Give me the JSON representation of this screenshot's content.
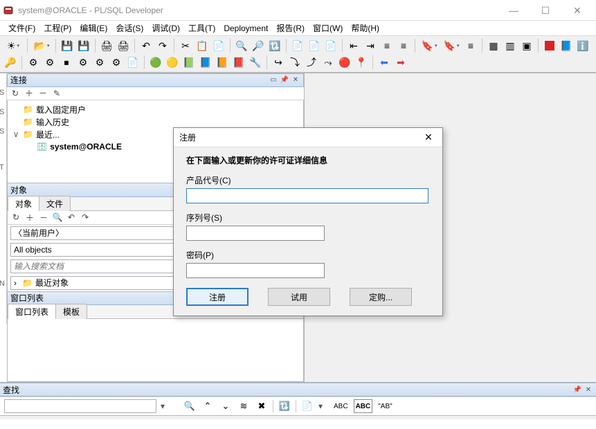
{
  "app": {
    "title": "system@ORACLE - PL/SQL Developer"
  },
  "menu": {
    "file": "文件(F)",
    "project": "工程(P)",
    "edit": "编辑(E)",
    "session": "会话(S)",
    "debug": "调试(D)",
    "tools": "工具(T)",
    "deployment": "Deployment",
    "report": "报告(R)",
    "window": "窗口(W)",
    "help": "帮助(H)"
  },
  "panels": {
    "connection": {
      "title": "连接",
      "items": {
        "fixed_user": "载入固定用户",
        "input_history": "输入历史",
        "recent": "最近...",
        "conn1": "system@ORACLE"
      }
    },
    "objects": {
      "title": "对象",
      "tabs": {
        "obj": "对象",
        "file": "文件"
      },
      "current_user": "〈当前用户〉",
      "all_objects": "All objects",
      "search_placeholder": "输入搜索文档",
      "recent_obj": "最近对象"
    },
    "winlist": {
      "title": "窗口列表",
      "tabs": {
        "list": "窗口列表",
        "template": "模板"
      }
    },
    "search": {
      "title": "查找",
      "abc": "ABC",
      "abc2": "ABC",
      "ab": "\"AB\""
    }
  },
  "dialog": {
    "title": "注册",
    "instruction": "在下面输入或更新你的许可证详细信息",
    "product_code_label": "产品代号(C)",
    "serial_label": "序列号(S)",
    "password_label": "密码(P)",
    "product_code": "",
    "serial": "",
    "password": "",
    "btn_register": "注册",
    "btn_trial": "试用",
    "btn_order": "定购..."
  }
}
